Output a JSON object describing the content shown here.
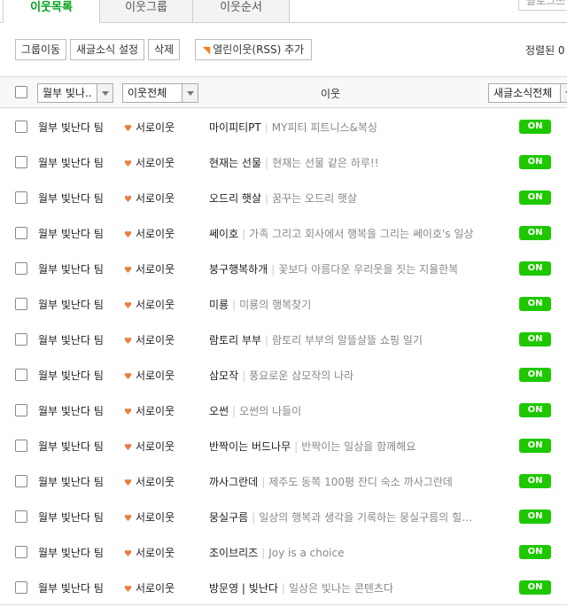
{
  "tabs": [
    "이웃목록",
    "이웃그룹",
    "이웃순서"
  ],
  "blog_button": "블로그쓰",
  "toolbar": {
    "move_group": "그룹이동",
    "feed_setting": "새글소식 설정",
    "delete": "삭제",
    "add_rss": "열린이웃(RSS) 추가",
    "sort_label": "정렬된 0"
  },
  "header": {
    "group_filter": "월부 빛나..",
    "type_filter": "이웃전체",
    "neighbor": "이웃",
    "feed_filter": "새글소식전체"
  },
  "colors": {
    "accent": "#00a31a",
    "toggle": "#1ec800",
    "heart": "#f07a3c"
  },
  "rows": [
    {
      "group": "월부 빛난다 팀",
      "type": "서로이웃",
      "nick": "마이피티PT",
      "title": "MY피티 피트니스&복싱",
      "status": "ON"
    },
    {
      "group": "월부 빛난다 팀",
      "type": "서로이웃",
      "nick": "현재는 선물",
      "title": "현재는 선물 같은 하루!!",
      "status": "ON"
    },
    {
      "group": "월부 빛난다 팀",
      "type": "서로이웃",
      "nick": "오드리 햇살",
      "title": "꿈꾸는 오드리 햇살",
      "status": "ON"
    },
    {
      "group": "월부 빛난다 팀",
      "type": "서로이웃",
      "nick": "쎄이호",
      "title": "가족 그리고 회사에서 행복을 그리는 쎄이호's 일상",
      "status": "ON"
    },
    {
      "group": "월부 빛난다 팀",
      "type": "서로이웃",
      "nick": "붕구행복하개",
      "title": "꽃보다 아름다운 우리웃을 짓는 지율한복",
      "status": "ON"
    },
    {
      "group": "월부 빛난다 팀",
      "type": "서로이웃",
      "nick": "미룡",
      "title": "미룡의 행복찾기",
      "status": "ON"
    },
    {
      "group": "월부 빛난다 팀",
      "type": "서로이웃",
      "nick": "람토리 부부",
      "title": "람토리 부부의 알뜰살뜰 쇼핑 일기",
      "status": "ON"
    },
    {
      "group": "월부 빛난다 팀",
      "type": "서로이웃",
      "nick": "삼모작",
      "title": "풍요로운 삼모작의 나라",
      "status": "ON"
    },
    {
      "group": "월부 빛난다 팀",
      "type": "서로이웃",
      "nick": "오썬",
      "title": "오썬의 나들이",
      "status": "ON"
    },
    {
      "group": "월부 빛난다 팀",
      "type": "서로이웃",
      "nick": "반짝이는 버드나무",
      "title": "반짝이는 일상을 함께해요",
      "status": "ON"
    },
    {
      "group": "월부 빛난다 팀",
      "type": "서로이웃",
      "nick": "까사그란데",
      "title": "제주도 동쪽 100평 잔디 숙소 까사그란데",
      "status": "ON"
    },
    {
      "group": "월부 빛난다 팀",
      "type": "서로이웃",
      "nick": "뭉실구름",
      "title": "일상의 행복과 생각을 기록하는 뭉실구름의 힐…",
      "status": "ON"
    },
    {
      "group": "월부 빛난다 팀",
      "type": "서로이웃",
      "nick": "조이브리즈",
      "title": "Joy is a choice",
      "status": "ON"
    },
    {
      "group": "월부 빛난다 팀",
      "type": "서로이웃",
      "nick": "방문영 | 빛난다",
      "title": "일상은 빛나는 콘텐츠다",
      "status": "ON"
    }
  ]
}
